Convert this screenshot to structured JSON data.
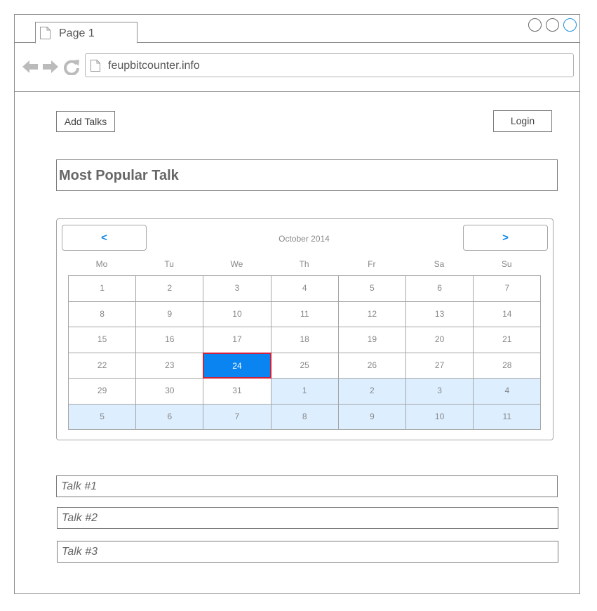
{
  "browser": {
    "tab_title": "Page 1",
    "url": "feupbitcounter.info"
  },
  "header": {
    "add_talks_label": "Add Talks",
    "login_label": "Login"
  },
  "most_popular": {
    "title": "Most Popular Talk"
  },
  "calendar": {
    "prev_label": "<",
    "next_label": ">",
    "month_label": "October 2014",
    "weekdays": [
      "Mo",
      "Tu",
      "We",
      "Th",
      "Fr",
      "Sa",
      "Su"
    ],
    "selected_day": "24",
    "weeks": [
      [
        {
          "d": "1"
        },
        {
          "d": "2"
        },
        {
          "d": "3"
        },
        {
          "d": "4"
        },
        {
          "d": "5"
        },
        {
          "d": "6"
        },
        {
          "d": "7"
        }
      ],
      [
        {
          "d": "8"
        },
        {
          "d": "9"
        },
        {
          "d": "10"
        },
        {
          "d": "11"
        },
        {
          "d": "12"
        },
        {
          "d": "13"
        },
        {
          "d": "14"
        }
      ],
      [
        {
          "d": "15"
        },
        {
          "d": "16"
        },
        {
          "d": "17"
        },
        {
          "d": "18"
        },
        {
          "d": "19"
        },
        {
          "d": "20"
        },
        {
          "d": "21"
        }
      ],
      [
        {
          "d": "22"
        },
        {
          "d": "23"
        },
        {
          "d": "24",
          "selected": true
        },
        {
          "d": "25"
        },
        {
          "d": "26"
        },
        {
          "d": "27"
        },
        {
          "d": "28"
        }
      ],
      [
        {
          "d": "29"
        },
        {
          "d": "30"
        },
        {
          "d": "31"
        },
        {
          "d": "1",
          "other": true
        },
        {
          "d": "2",
          "other": true
        },
        {
          "d": "3",
          "other": true
        },
        {
          "d": "4",
          "other": true
        }
      ],
      [
        {
          "d": "5",
          "other": true
        },
        {
          "d": "6",
          "other": true
        },
        {
          "d": "7",
          "other": true
        },
        {
          "d": "8",
          "other": true
        },
        {
          "d": "9",
          "other": true
        },
        {
          "d": "10",
          "other": true
        },
        {
          "d": "11",
          "other": true
        }
      ]
    ]
  },
  "talks": [
    "Talk #1",
    "Talk #2",
    "Talk #3"
  ],
  "colors": {
    "accent": "#0a84f0",
    "selected_border": "#d0203a",
    "other_month_bg": "#ddeeff",
    "window_button_active": "#1e90d6"
  }
}
